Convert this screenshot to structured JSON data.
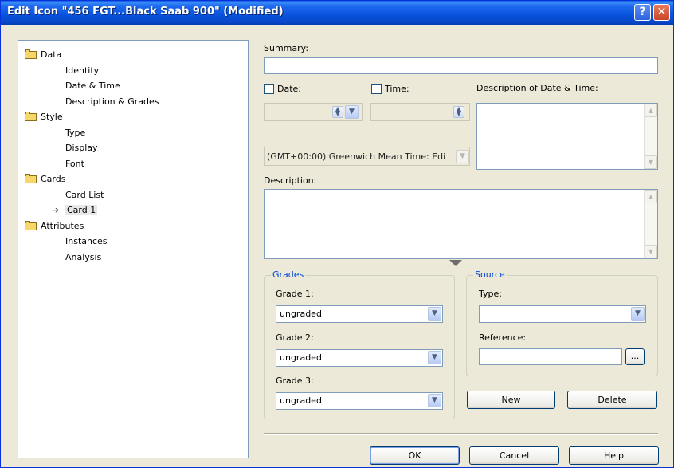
{
  "window": {
    "title": "Edit Icon \"456 FGT...Black Saab 900\" (Modified)",
    "help_glyph": "?",
    "close_glyph": "✕"
  },
  "tree": {
    "items": [
      {
        "label": "Data",
        "level": 0,
        "icon": "folder-icon"
      },
      {
        "label": "Identity",
        "level": 1
      },
      {
        "label": "Date & Time",
        "level": 1
      },
      {
        "label": "Description & Grades",
        "level": 1
      },
      {
        "label": "Style",
        "level": 0,
        "icon": "folder-icon"
      },
      {
        "label": "Type",
        "level": 1
      },
      {
        "label": "Display",
        "level": 1
      },
      {
        "label": "Font",
        "level": 1
      },
      {
        "label": "Cards",
        "level": 0,
        "icon": "folder-icon"
      },
      {
        "label": "Card List",
        "level": 1
      },
      {
        "label": "Card 1",
        "level": 1,
        "selected": true
      },
      {
        "label": "Attributes",
        "level": 0,
        "icon": "folder-icon"
      },
      {
        "label": "Instances",
        "level": 1
      },
      {
        "label": "Analysis",
        "level": 1
      }
    ]
  },
  "form": {
    "summary_label": "Summary:",
    "summary_value": "",
    "date_label": "Date:",
    "date_checked": false,
    "time_label": "Time:",
    "time_checked": false,
    "date_time_desc_label": "Description of Date & Time:",
    "timezone_value": "(GMT+00:00) Greenwich Mean Time: Edi",
    "description_label": "Description:",
    "description_value": ""
  },
  "grades": {
    "title": "Grades",
    "grade1_label": "Grade 1:",
    "grade1_value": "ungraded",
    "grade2_label": "Grade 2:",
    "grade2_value": "ungraded",
    "grade3_label": "Grade 3:",
    "grade3_value": "ungraded"
  },
  "source": {
    "title": "Source",
    "type_label": "Type:",
    "type_value": "",
    "reference_label": "Reference:",
    "reference_value": "",
    "browse_label": "..."
  },
  "buttons": {
    "new": "New",
    "delete": "Delete",
    "ok": "OK",
    "cancel": "Cancel",
    "help": "Help"
  },
  "colors": {
    "titlebar": "#0852dc",
    "group_title": "#0046d5",
    "dialog_bg": "#ece9d8"
  }
}
